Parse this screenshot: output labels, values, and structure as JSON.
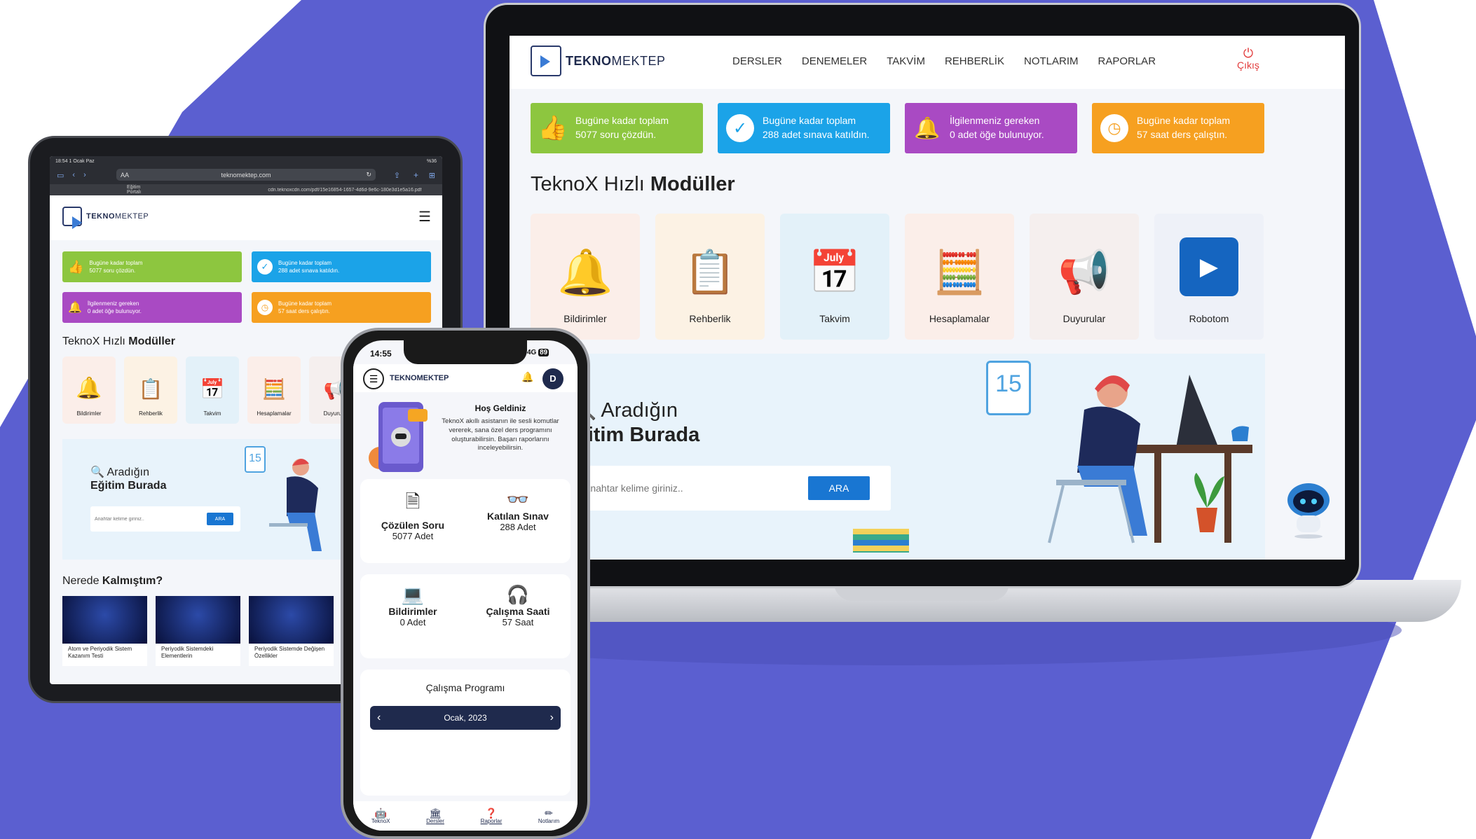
{
  "brand": {
    "name_bold": "TEKNO",
    "name_rest": "MEKTEP",
    "phone_name": "TEKNOMEKTEP"
  },
  "nav": {
    "items": [
      "DERSLER",
      "DENEMELER",
      "TAKVİM",
      "REHBERLİK",
      "NOTLARIM",
      "RAPORLAR"
    ],
    "logout": "Çıkış"
  },
  "stats": [
    {
      "line1": "Bugüne kadar toplam",
      "line2": "5077 soru çözdün.",
      "color": "#8dc63f",
      "icon": "thumbs-up-icon"
    },
    {
      "line1": "Bugüne kadar toplam",
      "line2": "288 adet sınava katıldın.",
      "color": "#1ba3e8",
      "icon": "check-icon"
    },
    {
      "line1": "İlgilenmeniz gereken",
      "line2": "0 adet öğe bulunuyor.",
      "color": "#a94ac3",
      "icon": "bell-icon"
    },
    {
      "line1": "Bugüne kadar toplam",
      "line2": "57 saat ders çalıştın.",
      "color": "#f6a020",
      "icon": "clock-icon"
    }
  ],
  "modules": {
    "title_plain": "TeknoX Hızlı ",
    "title_bold": "Modüller",
    "items": [
      {
        "label": "Bildirimler",
        "bg": "#fbeee9"
      },
      {
        "label": "Rehberlik",
        "bg": "#fcf2e4"
      },
      {
        "label": "Takvim",
        "bg": "#e3f1f9"
      },
      {
        "label": "Hesaplamalar",
        "bg": "#fbeee9"
      },
      {
        "label": "Duyurular",
        "bg": "#f5efee"
      },
      {
        "label": "Robotom",
        "bg": "#eef1f8"
      }
    ]
  },
  "search": {
    "line1": "Aradığın",
    "line2": "Eğitim Burada",
    "laptop_line1": "Aradığın",
    "laptop_line2": "ğitim Burada",
    "placeholder": "Anahtar kelime giriniz..",
    "button": "ARA",
    "calendar_day": "15"
  },
  "tablet": {
    "status_time": "18:54",
    "status_date": "1 Ocak Paz",
    "battery": "%36",
    "url": "teknomektep.com",
    "url_prefix": "AA",
    "tab1": "Eğitim Portalı",
    "tab2": "cdn.teknoxcdn.com/pdf/15e16854-1657-4d6d-9e6c-180e3d1e5a16.pdf",
    "continue_plain": "Nerede ",
    "continue_bold": "Kalmıştım?",
    "videos": [
      "Atom ve Periyodik Sistem Kazanım Testi",
      "Periyodik Sistemdeki Elementlerin",
      "Periyodik Sistemde Değişen Özellikler"
    ]
  },
  "phone": {
    "time": "14:55",
    "signal": "4G",
    "battery": "89",
    "avatar": "D",
    "welcome_title": "Hoş Geldiniz",
    "welcome_text": "TeknoX akıllı asistanın ile sesli komutlar vererek, sana özel ders programını oluşturabilirsin. Başarı raporlarını inceleyebilirsin.",
    "metrics": [
      {
        "title": "Çözülen Soru",
        "value": "5077 Adet"
      },
      {
        "title": "Katılan Sınav",
        "value": "288 Adet"
      },
      {
        "title": "Bildirimler",
        "value": "0 Adet"
      },
      {
        "title": "Çalışma Saati",
        "value": "57 Saat"
      }
    ],
    "schedule_title": "Çalışma Programı",
    "month": "Ocak, 2023",
    "tabs": [
      "TeknoX",
      "Dersler",
      "Raporlar",
      "Notlarım"
    ]
  },
  "colors": {
    "accent": "#1976d2",
    "background_shape": "#5b5fd0",
    "logout": "#e23b3b"
  }
}
